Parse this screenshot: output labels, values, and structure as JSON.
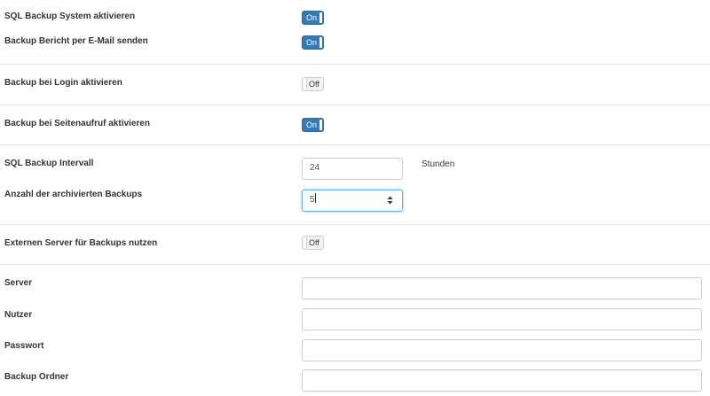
{
  "settings": {
    "sql_backup": {
      "label": "SQL Backup System aktivieren",
      "state": "On"
    },
    "email_report": {
      "label": "Backup Bericht per E-Mail senden",
      "state": "On"
    },
    "login_backup": {
      "label": "Backup bei Login aktivieren",
      "state": "Off"
    },
    "pageview_backup": {
      "label": "Backup bei Seitenaufruf aktivieren",
      "state": "On"
    },
    "interval": {
      "label": "SQL Backup Intervall",
      "value": "24",
      "unit": "Stunden"
    },
    "archive_count": {
      "label": "Anzahl der archivierten Backups",
      "value": "5"
    },
    "external_server": {
      "label": "Externen Server für Backups nutzen",
      "state": "Off"
    },
    "server": {
      "label": "Server",
      "value": ""
    },
    "user": {
      "label": "Nutzer",
      "value": ""
    },
    "password": {
      "label": "Passwort",
      "value": ""
    },
    "folder": {
      "label": "Backup Ordner",
      "value": ""
    }
  },
  "colors": {
    "toggle_on": "#337ab7",
    "toggle_off": "#f3f3f3",
    "focus_border": "#66afe9",
    "divider": "#e6e6e6"
  }
}
